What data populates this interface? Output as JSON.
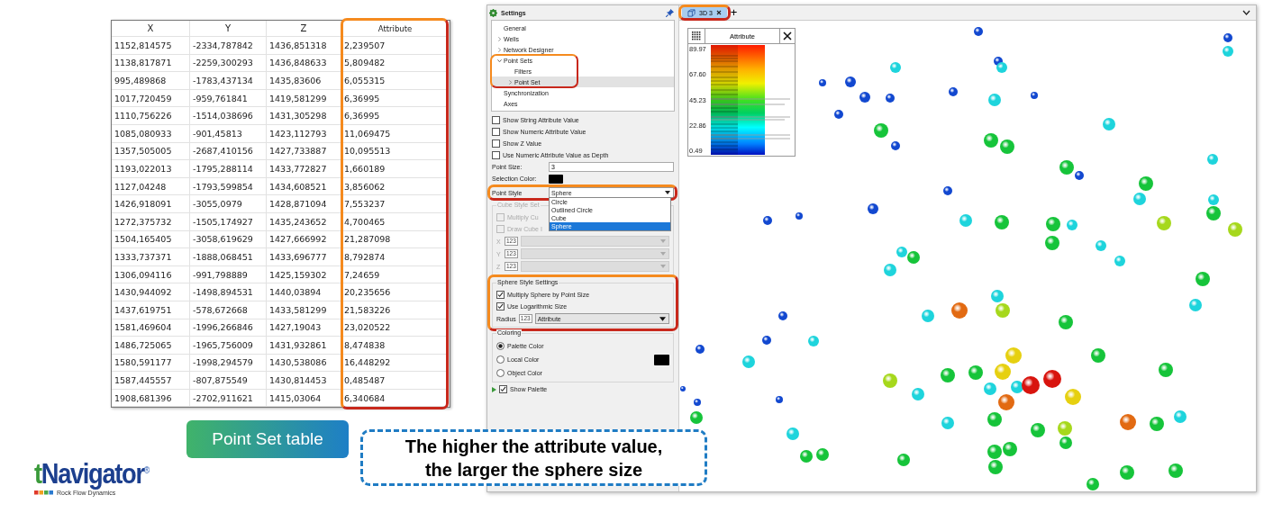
{
  "table": {
    "columns": [
      "X",
      "Y",
      "Z",
      "Attribute"
    ],
    "rows": [
      [
        "1152,814575",
        "-2334,787842",
        "1436,851318",
        "2,239507"
      ],
      [
        "1138,817871",
        "-2259,300293",
        "1436,848633",
        "5,809482"
      ],
      [
        "995,489868",
        "-1783,437134",
        "1435,83606",
        "6,055315"
      ],
      [
        "1017,720459",
        "-959,761841",
        "1419,581299",
        "6,36995"
      ],
      [
        "1110,756226",
        "-1514,038696",
        "1431,305298",
        "6,36995"
      ],
      [
        "1085,080933",
        "-901,45813",
        "1423,112793",
        "11,069475"
      ],
      [
        "1357,505005",
        "-2687,410156",
        "1427,733887",
        "10,095513"
      ],
      [
        "1193,022013",
        "-1795,288114",
        "1433,772827",
        "1,660189"
      ],
      [
        "1127,04248",
        "-1793,599854",
        "1434,608521",
        "3,856062"
      ],
      [
        "1426,918091",
        "-3055,0979",
        "1428,871094",
        "7,553237"
      ],
      [
        "1272,375732",
        "-1505,174927",
        "1435,243652",
        "4,700465"
      ],
      [
        "1504,165405",
        "-3058,619629",
        "1427,666992",
        "21,287098"
      ],
      [
        "1333,737371",
        "-1888,068451",
        "1433,696777",
        "8,792874"
      ],
      [
        "1306,094116",
        "-991,798889",
        "1425,159302",
        "7,24659"
      ],
      [
        "1430,944092",
        "-1498,894531",
        "1440,03894",
        "20,235656"
      ],
      [
        "1437,619751",
        "-578,672668",
        "1433,581299",
        "21,583226"
      ],
      [
        "1581,469604",
        "-1996,266846",
        "1427,19043",
        "23,020522"
      ],
      [
        "1486,725065",
        "-1965,756009",
        "1431,932861",
        "8,474838"
      ],
      [
        "1580,591177",
        "-1998,294579",
        "1430,538086",
        "16,448292"
      ],
      [
        "1587,445557",
        "-807,875549",
        "1430,814453",
        "0,485487"
      ],
      [
        "1908,681396",
        "-2702,911621",
        "1415,03064",
        "6,340684"
      ]
    ]
  },
  "caption_badge": {
    "label": "Point Set table"
  },
  "callout": {
    "lines": [
      "The higher the attribute value,",
      "the larger the sphere size"
    ]
  },
  "logo": {
    "name": "tNavigator",
    "mark": "®",
    "tagline": "Rock Flow Dynamics"
  },
  "settings": {
    "title": "Settings",
    "tree": [
      {
        "label": "General",
        "selected": false
      },
      {
        "label": "Wells",
        "selected": false,
        "expanded": false
      },
      {
        "label": "Network Designer",
        "selected": false,
        "expanded": false
      },
      {
        "label": "Point Sets",
        "selected": false,
        "expanded": true,
        "children": [
          {
            "label": "Filters",
            "selected": false
          },
          {
            "label": "Point Set",
            "selected": true,
            "expanded": false
          }
        ]
      },
      {
        "label": "Synchronization",
        "selected": false
      },
      {
        "label": "Axes",
        "selected": false
      }
    ],
    "checkboxes": [
      {
        "label": "Show String Attribute Value",
        "checked": false
      },
      {
        "label": "Show Numeric Attribute Value",
        "checked": false
      },
      {
        "label": "Show Z Value",
        "checked": false
      },
      {
        "label": "Use Numeric Attribute Value as Depth",
        "checked": false
      }
    ],
    "point_size": {
      "label": "Point Size:",
      "value": "3"
    },
    "selection_color": {
      "label": "Selection Color:"
    },
    "point_style": {
      "label": "Point Style",
      "value": "Sphere",
      "options": [
        {
          "label": "Circle",
          "selected": false
        },
        {
          "label": "Outlined Circle",
          "selected": false
        },
        {
          "label": "Cube",
          "selected": false
        },
        {
          "label": "Sphere",
          "selected": true
        }
      ]
    },
    "cube_style": {
      "title": "Cube Style Set",
      "checkboxes": [
        {
          "label": "Multiply Cu",
          "checked": false
        },
        {
          "label": "Draw Cube I",
          "checked": false
        }
      ],
      "axes": [
        {
          "label": "X",
          "type_icon": "123"
        },
        {
          "label": "Y",
          "type_icon": "123"
        },
        {
          "label": "Z",
          "type_icon": "123"
        }
      ]
    },
    "sphere_style": {
      "title": "Sphere Style Settings",
      "checkboxes": [
        {
          "label": "Multiply Sphere by Point Size",
          "checked": true
        },
        {
          "label": "Use Logarithmic Size",
          "checked": true
        }
      ],
      "radius": {
        "label": "Radius",
        "type_icon": "123",
        "value": "Attribute"
      }
    },
    "coloring": {
      "title": "Coloring",
      "options": [
        {
          "label": "Palette Color",
          "selected": true,
          "swatch": false
        },
        {
          "label": "Local Color",
          "selected": false,
          "swatch": true
        },
        {
          "label": "Object Color",
          "selected": false,
          "swatch": false
        }
      ]
    },
    "show_palette": {
      "label": "Show Palette",
      "checked": true
    }
  },
  "view": {
    "tabs": [
      {
        "label": "3D 3",
        "selected": true
      }
    ],
    "add_tab": "+",
    "legend": {
      "title": "Attribute",
      "ticks": [
        "89.97",
        "67.60",
        "45.23",
        "22.86",
        "0.49"
      ]
    }
  }
}
